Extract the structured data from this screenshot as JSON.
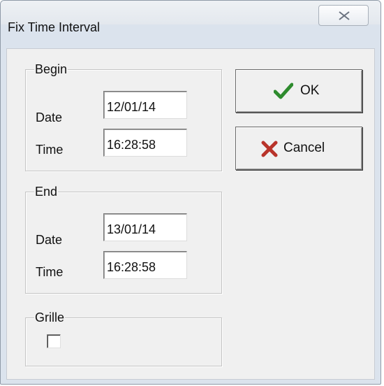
{
  "window": {
    "title": "Fix Time Interval"
  },
  "begin": {
    "label": "Begin",
    "date_label": "Date",
    "date_value": "12/01/14",
    "time_label": "Time",
    "time_value": "16:28:58"
  },
  "end": {
    "label": "End",
    "date_label": "Date",
    "date_value": "13/01/14",
    "time_label": "Time",
    "time_value": "16:28:58"
  },
  "grille": {
    "label": "Grille",
    "checked": false
  },
  "buttons": {
    "ok_label": "OK",
    "ok_icon": "checkmark-icon",
    "ok_icon_color": "#2e8b2e",
    "cancel_label": "Cancel",
    "cancel_icon": "x-cross-icon",
    "cancel_icon_color": "#b8332a"
  },
  "colors": {
    "titlebar": "#e6ebf1",
    "dialog_bg": "#f0f0f0"
  }
}
